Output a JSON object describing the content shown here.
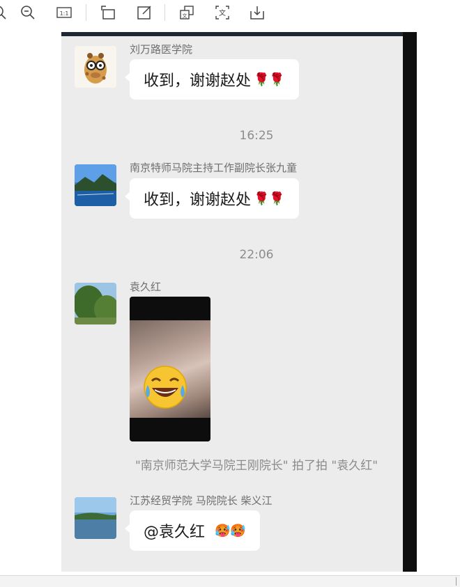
{
  "toolbar": {
    "icons": [
      "zoom-out-icon",
      "actual-size-icon",
      "rotate-icon",
      "edit-icon",
      "crop-icon",
      "translate-icon",
      "download-icon"
    ],
    "actual_size_label": "1:1",
    "translate_label": "文"
  },
  "chat": {
    "messages": [
      {
        "sender": "刘万路医学院",
        "text": "收到，谢谢赵处",
        "emoji": "🌹🌹"
      },
      {
        "sender": "南京特师马院主持工作副院长张九童",
        "text": "收到，谢谢赵处",
        "emoji": "🌹🌹"
      },
      {
        "sender": "袁久红",
        "sticker": "😂"
      },
      {
        "sender": "江苏经贸学院 马院院长  柴义江",
        "text": "@袁久红",
        "emoji": "🥵🥵"
      }
    ],
    "timestamps": [
      "16:25",
      "22:06"
    ],
    "pat_notice": "\"南京师范大学马院王刚院长\" 拍了拍 \"袁久红\""
  },
  "colors": {
    "chat_background": "#ececec",
    "bubble": "#ffffff",
    "meta_text": "#8c8c8c"
  }
}
